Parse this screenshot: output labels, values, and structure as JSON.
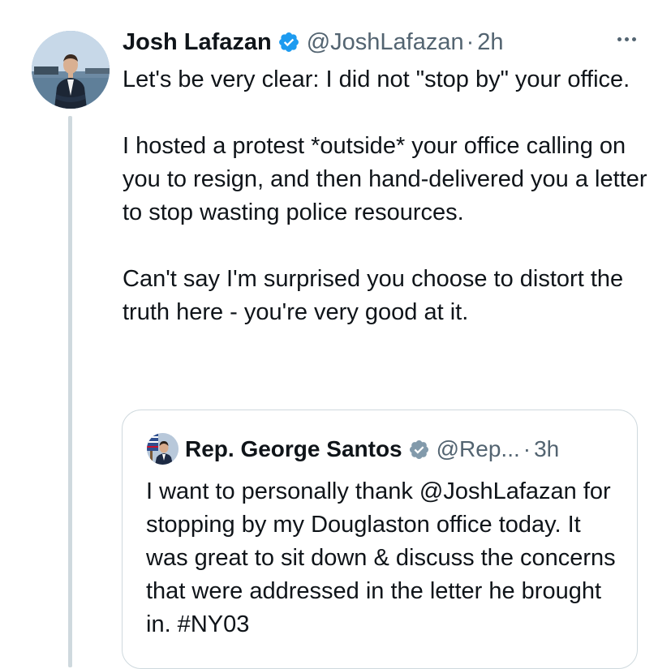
{
  "tweet": {
    "author": {
      "name": "Josh Lafazan",
      "handle": "@JoshLafazan",
      "separator": "·",
      "time": "2h",
      "avatar_icon": "profile-photo",
      "verified_icon": "verified-badge-icon",
      "verified_color": "#1d9bf0"
    },
    "more_icon": "more-options-icon",
    "paragraphs": [
      "Let's be very clear: I did not \"stop by\" your office.",
      "I hosted a protest *outside* your office calling on you to resign, and then hand-delivered you a letter to stop wasting police resources.",
      "Can't say I'm surprised you choose to distort the truth here - you're very good at it."
    ]
  },
  "quoted": {
    "author": {
      "name": "Rep. George Santos",
      "handle": "@Rep...",
      "separator": "·",
      "time": "3h",
      "verified_icon": "government-verified-badge-icon",
      "verified_color": "#829aab"
    },
    "text": "I want to personally thank @JoshLafazan for stopping by my Douglaston office today. It was great to sit down & discuss the concerns that were addressed in the letter he brought in. #NY03"
  },
  "colors": {
    "text_primary": "#0f1419",
    "text_secondary": "#536471",
    "border": "#cfd9de",
    "accent": "#1d9bf0"
  }
}
